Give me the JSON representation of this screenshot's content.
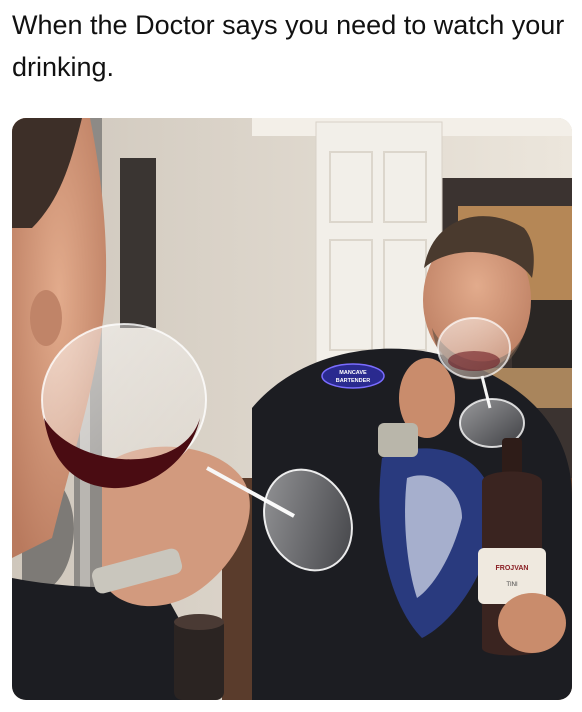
{
  "caption": "When the Doctor says you need to watch your drinking.",
  "photo": {
    "shirt_logo": [
      "MANCAVE",
      "BARTENDER"
    ],
    "bottle_label": [
      "FROJVAN",
      "TINI"
    ],
    "colors": {
      "wall": "#e4ddd2",
      "door": "#f2efe9",
      "wine": "#4a0c12",
      "shirt": "#1c1d22",
      "skin": "#d39a7c"
    }
  }
}
